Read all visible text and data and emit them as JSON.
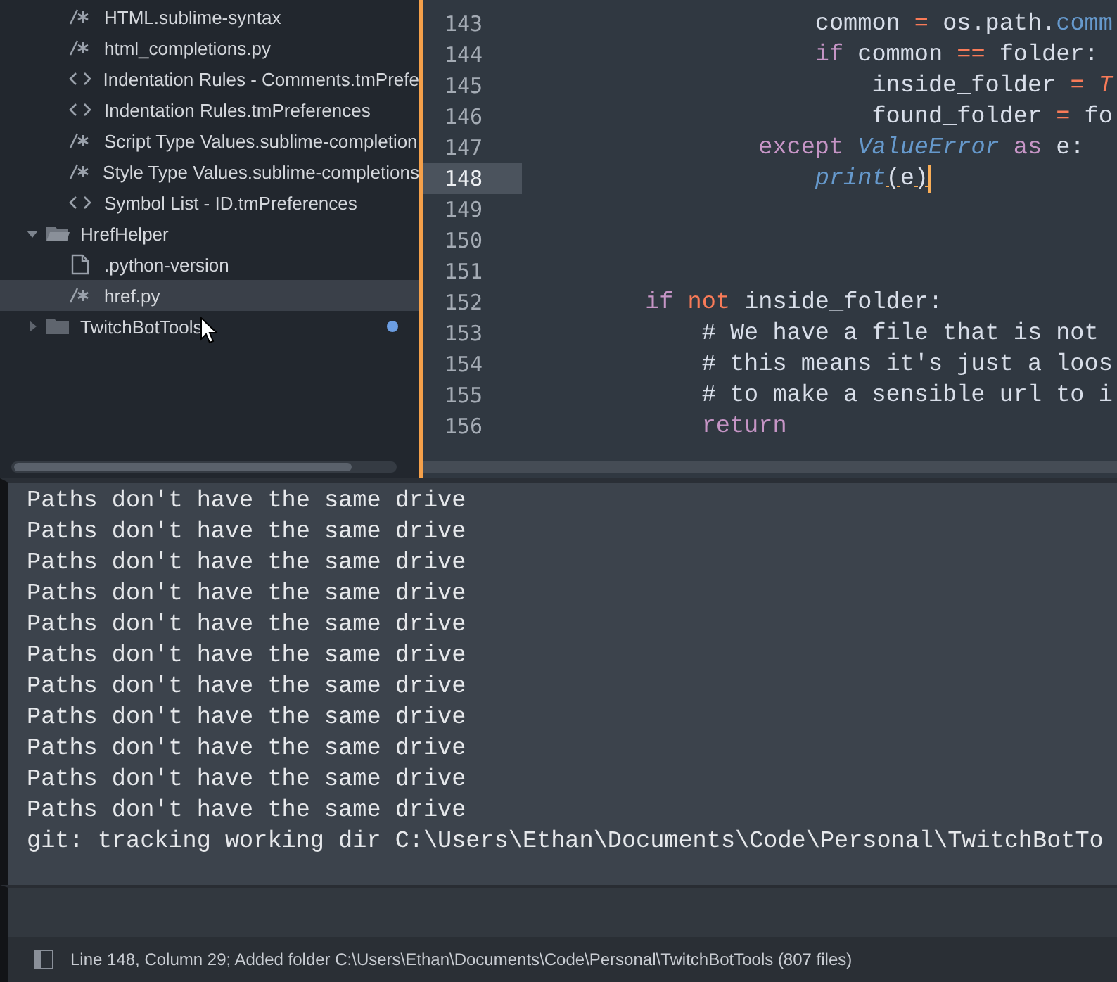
{
  "sidebar": {
    "items": [
      {
        "kind": "code-file",
        "name": "HTML.sublime-syntax",
        "selected": false
      },
      {
        "kind": "code-file",
        "name": "html_completions.py",
        "selected": false
      },
      {
        "kind": "markup-file",
        "name": "Indentation Rules - Comments.tmPrefe",
        "selected": false
      },
      {
        "kind": "markup-file",
        "name": "Indentation Rules.tmPreferences",
        "selected": false
      },
      {
        "kind": "code-file",
        "name": "Script Type Values.sublime-completion",
        "selected": false
      },
      {
        "kind": "code-file",
        "name": "Style Type Values.sublime-completions",
        "selected": false
      },
      {
        "kind": "markup-file",
        "name": "Symbol List - ID.tmPreferences",
        "selected": false
      },
      {
        "kind": "folder",
        "name": "HrefHelper",
        "expanded": true,
        "modified": false,
        "selected": false,
        "children": [
          {
            "kind": "plain-file",
            "name": ".python-version",
            "selected": false
          },
          {
            "kind": "code-file",
            "name": "href.py",
            "selected": true
          }
        ]
      },
      {
        "kind": "folder",
        "name": "TwitchBotTools",
        "expanded": false,
        "modified": true,
        "selected": false
      }
    ]
  },
  "editor": {
    "lines": [
      {
        "number": "143",
        "current": false,
        "tokens": [
          {
            "text": "                    common ",
            "kind": "plain"
          },
          {
            "text": "= ",
            "kind": "operator"
          },
          {
            "text": "os.path.",
            "kind": "plain"
          },
          {
            "text": "comm",
            "kind": "function"
          }
        ]
      },
      {
        "number": "144",
        "current": false,
        "tokens": [
          {
            "text": "                    if ",
            "kind": "keyword"
          },
          {
            "text": "common ",
            "kind": "plain"
          },
          {
            "text": "== ",
            "kind": "operator"
          },
          {
            "text": "folder:",
            "kind": "plain"
          }
        ]
      },
      {
        "number": "145",
        "current": false,
        "tokens": [
          {
            "text": "                        inside_folder ",
            "kind": "plain"
          },
          {
            "text": "= ",
            "kind": "operator"
          },
          {
            "text": "T",
            "kind": "constant"
          }
        ]
      },
      {
        "number": "146",
        "current": false,
        "tokens": [
          {
            "text": "                        found_folder ",
            "kind": "plain"
          },
          {
            "text": "= ",
            "kind": "operator"
          },
          {
            "text": "fo",
            "kind": "plain"
          }
        ]
      },
      {
        "number": "147",
        "current": false,
        "tokens": [
          {
            "text": "                except ",
            "kind": "keyword"
          },
          {
            "text": "ValueError ",
            "kind": "type"
          },
          {
            "text": "as ",
            "kind": "keyword"
          },
          {
            "text": "e:",
            "kind": "plain"
          }
        ]
      },
      {
        "number": "148",
        "current": true,
        "tokens": [
          {
            "text": "                    print",
            "kind": "type"
          },
          {
            "text": "(",
            "kind": "bracket"
          },
          {
            "text": "e",
            "kind": "plain"
          },
          {
            "text": ")",
            "kind": "bracket"
          }
        ]
      },
      {
        "number": "149",
        "current": false
      },
      {
        "number": "150",
        "current": false
      },
      {
        "number": "151",
        "current": false
      },
      {
        "number": "152",
        "current": false,
        "tokens": [
          {
            "text": "        if ",
            "kind": "keyword"
          },
          {
            "text": "not ",
            "kind": "operator"
          },
          {
            "text": "inside_folder:",
            "kind": "plain"
          }
        ]
      },
      {
        "number": "153",
        "current": false,
        "tokens": [
          {
            "text": "            # We have a file that is not",
            "kind": "comment"
          }
        ]
      },
      {
        "number": "154",
        "current": false,
        "tokens": [
          {
            "text": "            # this means it's just a loos",
            "kind": "comment"
          }
        ]
      },
      {
        "number": "155",
        "current": false,
        "tokens": [
          {
            "text": "            # to make a sensible url to i",
            "kind": "comment"
          }
        ]
      },
      {
        "number": "156",
        "current": false,
        "tokens": [
          {
            "text": "            return",
            "kind": "keyword"
          }
        ]
      }
    ]
  },
  "console": {
    "lines": [
      "Paths don't have the same drive",
      "Paths don't have the same drive",
      "Paths don't have the same drive",
      "Paths don't have the same drive",
      "Paths don't have the same drive",
      "Paths don't have the same drive",
      "Paths don't have the same drive",
      "Paths don't have the same drive",
      "Paths don't have the same drive",
      "Paths don't have the same drive",
      "Paths don't have the same drive",
      "git: tracking working dir C:\\Users\\Ethan\\Documents\\Code\\Personal\\TwitchBotTo"
    ]
  },
  "status_bar": {
    "text": "Line 148, Column 29; Added folder C:\\Users\\Ethan\\Documents\\Code\\Personal\\TwitchBotTools (807 files)"
  }
}
